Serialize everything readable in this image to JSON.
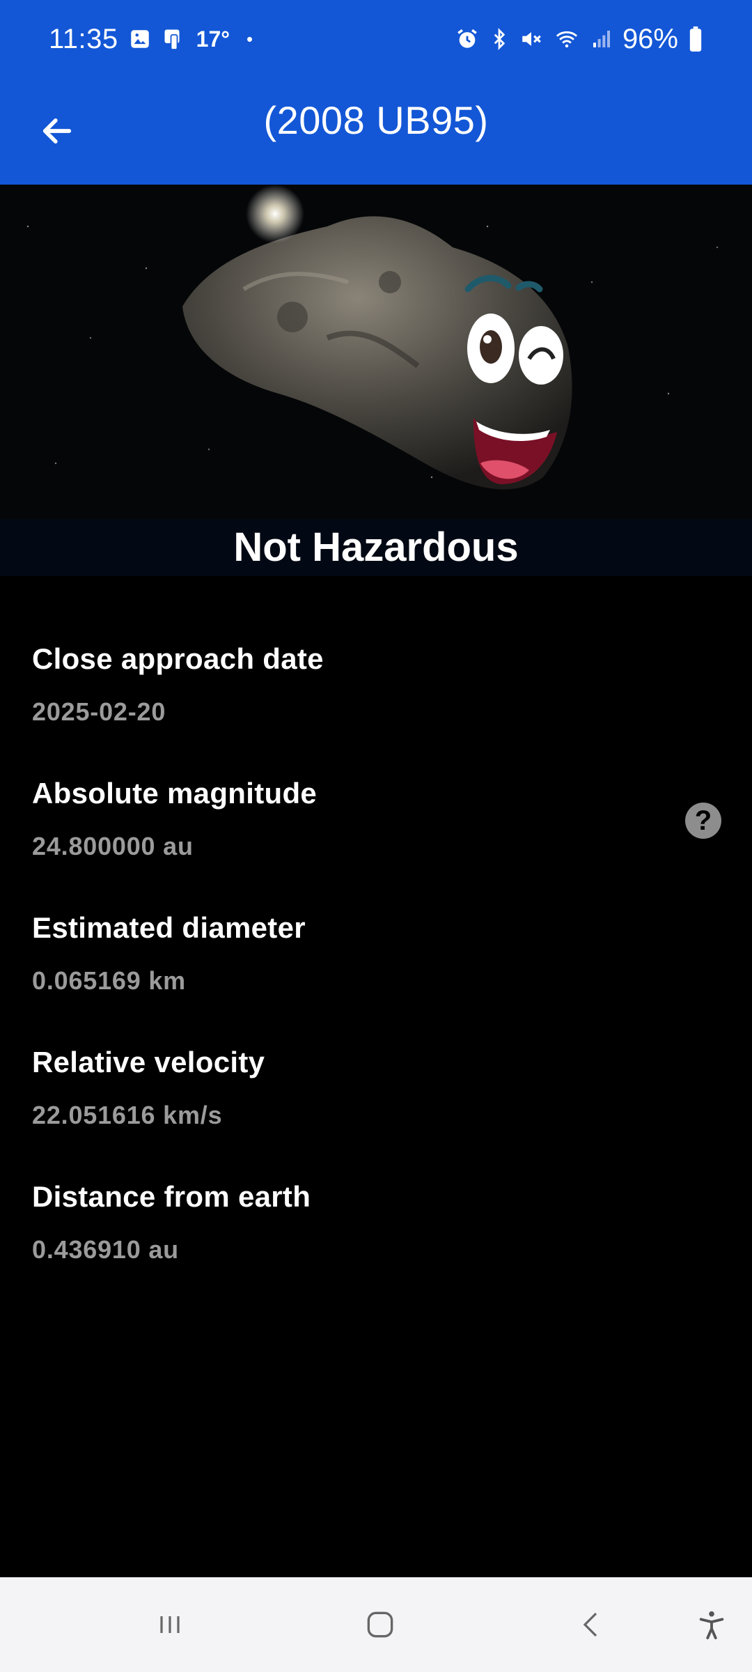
{
  "status_bar": {
    "time": "11:35",
    "temperature": "17°",
    "dot": "•",
    "battery": "96%",
    "icons": [
      "gallery-icon",
      "device-icon",
      "alarm-icon",
      "bluetooth-icon",
      "mute-icon",
      "wifi-icon",
      "signal-icon",
      "battery-icon"
    ]
  },
  "app_bar": {
    "title": "(2008 UB95)",
    "back_icon": "arrow-left-icon"
  },
  "hero": {
    "status": "Not Hazardous"
  },
  "details": [
    {
      "label": "Close approach date",
      "value": "2025-02-20"
    },
    {
      "label": "Absolute magnitude",
      "value": "24.800000 au",
      "help": "?"
    },
    {
      "label": "Estimated diameter",
      "value": "0.065169 km"
    },
    {
      "label": "Relative velocity",
      "value": "22.051616 km/s"
    },
    {
      "label": "Distance from earth",
      "value": "0.436910 au"
    }
  ],
  "nav_bar": {
    "icons": [
      "recent-apps-icon",
      "home-icon",
      "back-icon",
      "accessibility-icon"
    ]
  },
  "colors": {
    "primary": "#1357d6",
    "background": "#000000",
    "value_text": "#9b9b9b"
  }
}
